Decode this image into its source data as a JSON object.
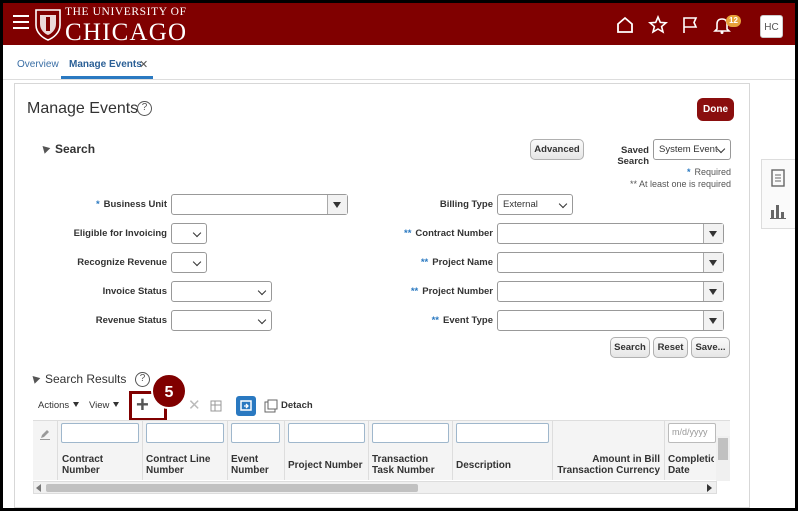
{
  "header": {
    "logo_small": "THE UNIVERSITY OF",
    "logo_big": "CHICAGO",
    "notification_count": "12",
    "avatar_initials": "HC"
  },
  "tabs": [
    {
      "label": "Overview"
    },
    {
      "label": "Manage Events"
    }
  ],
  "page": {
    "title": "Manage Events",
    "done_label": "Done"
  },
  "search": {
    "title": "Search",
    "advanced_label": "Advanced",
    "saved_search_label": "Saved Search",
    "saved_search_value": "System Event",
    "required_note": "Required",
    "at_least_one_note": "** At least one is required",
    "fields": {
      "business_unit": "Business Unit",
      "eligible_for_invoicing": "Eligible for Invoicing",
      "recognize_revenue": "Recognize Revenue",
      "invoice_status": "Invoice Status",
      "revenue_status": "Revenue Status",
      "billing_type": "Billing Type",
      "billing_type_value": "External",
      "contract_number": "Contract Number",
      "project_name": "Project Name",
      "project_number": "Project Number",
      "event_type": "Event Type"
    },
    "search_btn": "Search",
    "reset_btn": "Reset",
    "save_btn": "Save..."
  },
  "results": {
    "title": "Search Results",
    "actions_label": "Actions",
    "view_label": "View",
    "detach_label": "Detach",
    "step_number": "5",
    "date_placeholder": "m/d/yyyy",
    "columns": [
      {
        "l1": "Contract",
        "l2": "Number"
      },
      {
        "l1": "Contract Line",
        "l2": "Number"
      },
      {
        "l1": "Event",
        "l2": "Number"
      },
      {
        "l1": "Project Number",
        "l2": ""
      },
      {
        "l1": "Transaction",
        "l2": "Task Number"
      },
      {
        "l1": "Description",
        "l2": ""
      },
      {
        "l1": "Amount in Bill",
        "l2": "Transaction Currency"
      },
      {
        "l1": "Completic",
        "l2": "Date"
      }
    ]
  },
  "colors": {
    "brand": "#800000",
    "accent": "#2a79c1"
  }
}
